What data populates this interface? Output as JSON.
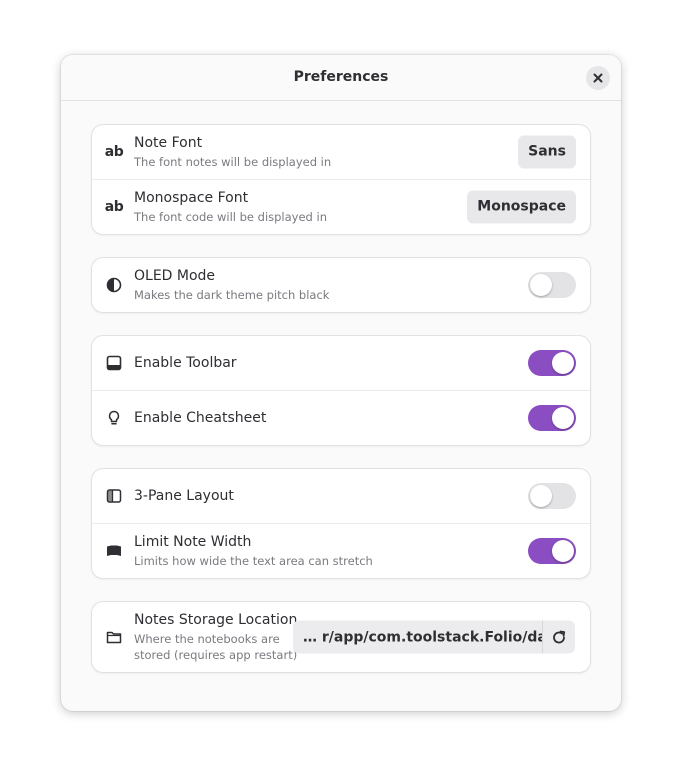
{
  "window": {
    "title": "Preferences",
    "close_icon": "close-icon"
  },
  "fonts_group": {
    "note_font": {
      "icon": "font-ab-icon",
      "icon_text": "ab",
      "title": "Note Font",
      "subtitle": "The font notes will be displayed in",
      "value": "Sans"
    },
    "mono_font": {
      "icon": "font-ab-icon",
      "icon_text": "ab",
      "title": "Monospace Font",
      "subtitle": "The font code will be displayed in",
      "value": "Monospace"
    }
  },
  "oled_group": {
    "oled_mode": {
      "icon": "contrast-icon",
      "title": "OLED Mode",
      "subtitle": "Makes the dark theme pitch black",
      "enabled": false
    }
  },
  "toolbar_group": {
    "enable_toolbar": {
      "icon": "toolbar-icon",
      "title": "Enable Toolbar",
      "enabled": true
    },
    "enable_cheatsheet": {
      "icon": "lightbulb-icon",
      "title": "Enable Cheatsheet",
      "enabled": true
    }
  },
  "layout_group": {
    "three_pane": {
      "icon": "sidebar-icon",
      "title": "3-Pane Layout",
      "enabled": false
    },
    "limit_width": {
      "icon": "page-width-icon",
      "title": "Limit Note Width",
      "subtitle": "Limits how wide the text area can stretch",
      "enabled": true
    }
  },
  "storage_group": {
    "location": {
      "icon": "folder-icon",
      "title": "Notes Storage Location",
      "subtitle_line1": "Where the notebooks are",
      "subtitle_line2": "stored (requires app restart)",
      "path": "… r/app/com.toolstack.Folio/data",
      "reset_icon": "refresh-icon"
    }
  },
  "colors": {
    "accent": "#8b4ec2",
    "switch_off": "#e3e3e6",
    "window_bg": "#fafafb",
    "card_bg": "#ffffff"
  }
}
